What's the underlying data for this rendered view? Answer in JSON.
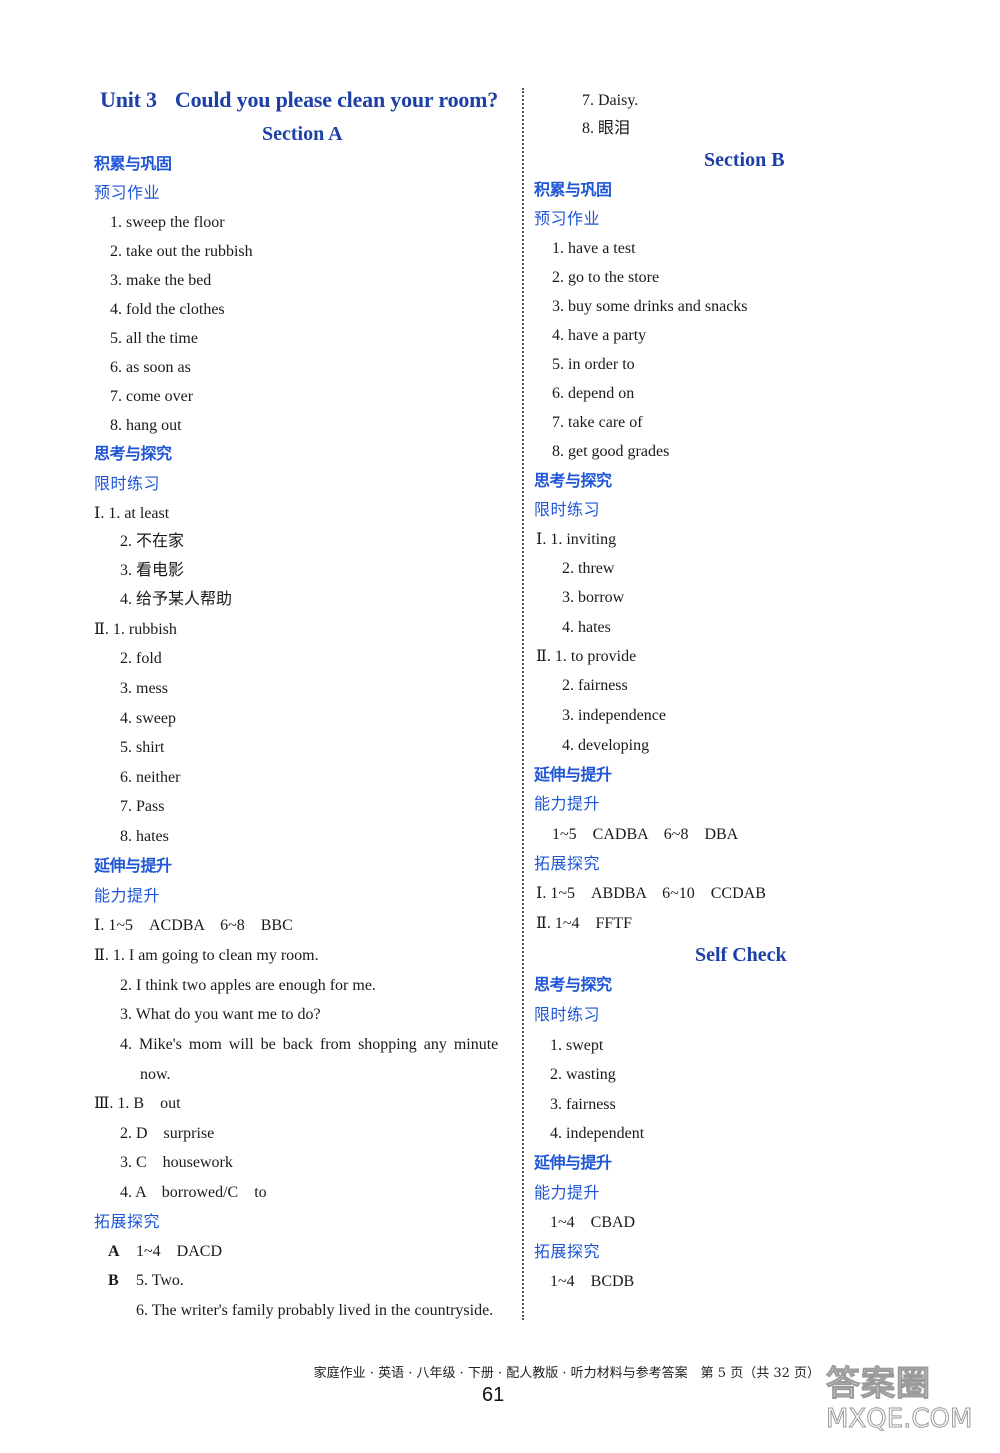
{
  "unit": {
    "label": "Unit 3",
    "title": "Could you please clean your room?"
  },
  "sectionA": {
    "title": "Section A",
    "block1": {
      "heading": "积累与巩固",
      "sub": "预习作业",
      "items": [
        "1. sweep the floor",
        "2. take out the rubbish",
        "3. make the bed",
        "4. fold the clothes",
        "5. all the time",
        "6. as soon as",
        "7. come over",
        "8. hang out"
      ]
    },
    "block2": {
      "heading": "思考与探究",
      "sub": "限时练习",
      "I": [
        "Ⅰ. 1. at least",
        "2. 不在家",
        "3. 看电影",
        "4. 给予某人帮助"
      ],
      "II": [
        "Ⅱ. 1. rubbish",
        "2. fold",
        "3. mess",
        "4. sweep",
        "5. shirt",
        "6. neither",
        "7. Pass",
        "8. hates"
      ]
    },
    "block3": {
      "heading": "延伸与提升",
      "sub": "能力提升",
      "I": "Ⅰ. 1~5　ACDBA　6~8　BBC",
      "II": [
        "Ⅱ. 1. I am going to clean my room.",
        "2. I think two apples are enough for me.",
        "3. What do you want me to do?",
        "4. Mike's mom will be back from shopping any minute",
        "now."
      ],
      "III": [
        "Ⅲ. 1. B　out",
        "2. D　surprise",
        "3. C　housework",
        "4. A　borrowed/C　to"
      ]
    },
    "block4": {
      "sub": "拓展探究",
      "A_tag": "A",
      "A": "1~4　DACD",
      "B_tag": "B",
      "B": [
        "5. Two.",
        "6. The writer's family probably lived in the countryside."
      ]
    }
  },
  "sectionA_cont": [
    "7. Daisy.",
    "8. 眼泪"
  ],
  "sectionB": {
    "title": "Section B",
    "block1": {
      "heading": "积累与巩固",
      "sub": "预习作业",
      "items": [
        "1. have a test",
        "2. go to the store",
        "3. buy some drinks and snacks",
        "4. have a party",
        "5. in order to",
        "6. depend on",
        "7. take care of",
        "8. get good grades"
      ]
    },
    "block2": {
      "heading": "思考与探究",
      "sub": "限时练习",
      "I": [
        "Ⅰ. 1. inviting",
        "2. threw",
        "3. borrow",
        "4. hates"
      ],
      "II": [
        "Ⅱ. 1. to provide",
        "2. fairness",
        "3. independence",
        "4. developing"
      ]
    },
    "block3": {
      "heading": "延伸与提升",
      "sub": "能力提升",
      "answer": "1~5　CADBA　6~8　DBA",
      "sub2": "拓展探究",
      "I": "Ⅰ. 1~5　ABDBA　6~10　CCDAB",
      "II": "Ⅱ. 1~4　FFTF"
    }
  },
  "selfCheck": {
    "title": "Self Check",
    "heading": "思考与探究",
    "sub": "限时练习",
    "items": [
      "1. swept",
      "2. wasting",
      "3. fairness",
      "4. independent"
    ],
    "heading2": "延伸与提升",
    "sub2": "能力提升",
    "answer2": "1~4　CBAD",
    "sub3": "拓展探究",
    "answer3": "1~4　BCDB"
  },
  "footer": {
    "text": "家庭作业 · 英语 · 八年级 · 下册 · 配人教版 · 听力材料与参考答案　第 5 页（共 32 页）",
    "page_number": "61"
  },
  "watermark": {
    "cn": "答案圈",
    "en": "MXQE.COM"
  }
}
